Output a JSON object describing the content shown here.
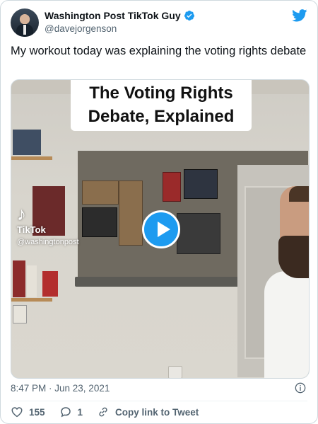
{
  "tweet": {
    "author": {
      "display_name": "Washington Post TikTok Guy",
      "handle": "@davejorgenson",
      "verified": true
    },
    "text": "My workout today was explaining the voting rights debate",
    "media": {
      "caption_line1": "The Voting Rights",
      "caption_line2": "Debate, Explained",
      "tiktok_logo": "♪",
      "tiktok_brand": "TikTok",
      "tiktok_user": "@washingtonpost",
      "play_icon": "play-icon"
    },
    "timestamp": "8:47 PM · Jun 23, 2021",
    "likes": "155",
    "replies": "1",
    "copy_link_label": "Copy link to Tweet"
  },
  "colors": {
    "accent": "#1d9bf0",
    "text": "#0f1419",
    "muted": "#536471",
    "border": "#cfd9de"
  },
  "icons": [
    "twitter-bird-icon",
    "verified-badge-icon",
    "info-icon",
    "heart-icon",
    "reply-icon",
    "link-icon"
  ]
}
